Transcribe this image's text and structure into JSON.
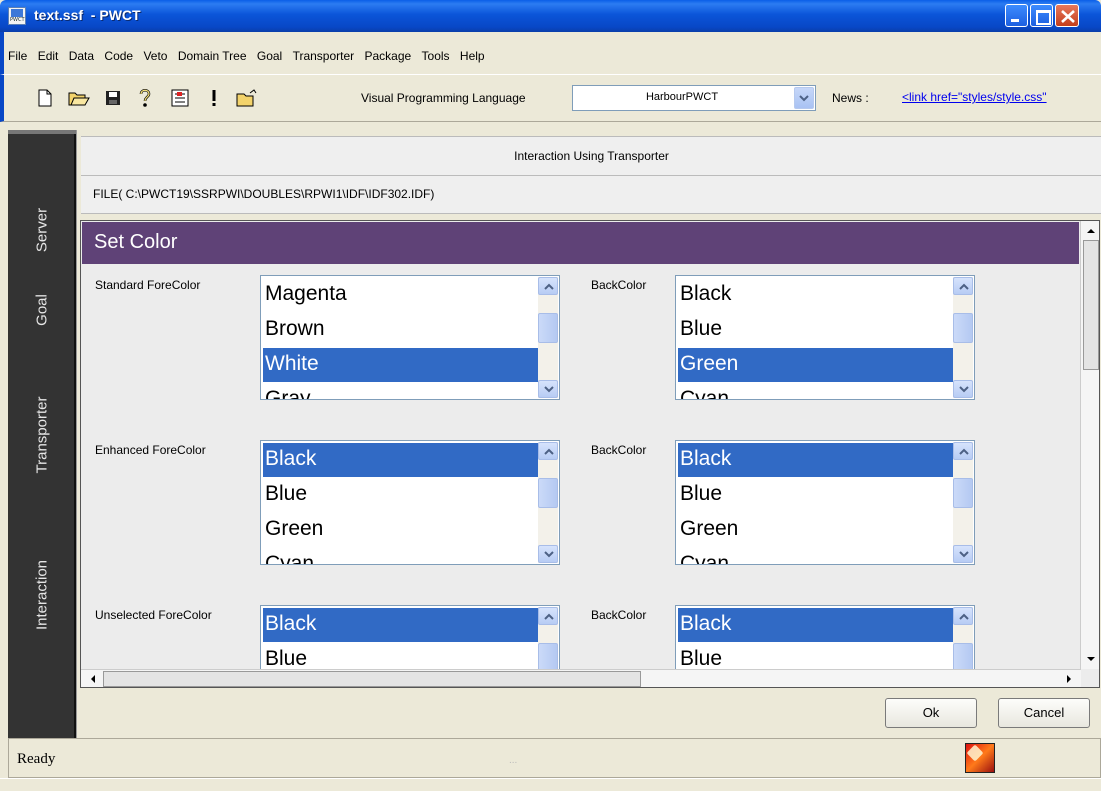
{
  "window": {
    "title": "text.ssf  - PWCT",
    "app_icon_label": "PWCT"
  },
  "menu": [
    "File",
    "Edit",
    "Data",
    "Code",
    "Veto",
    "Domain Tree",
    "Goal",
    "Transporter",
    "Package",
    "Tools",
    "Help"
  ],
  "toolbar": {
    "icons": [
      "new-file-icon",
      "open-folder-icon",
      "save-icon",
      "help-icon",
      "document-icon",
      "exclamation-icon",
      "folder-icon"
    ],
    "vpl_label": "Visual Programming Language",
    "vpl_selected": "HarbourPWCT",
    "news_label": "News :",
    "news_link": "<link href=\"styles/style.css\""
  },
  "sidebar": {
    "items": [
      "Server",
      "Goal",
      "Transporter",
      "Interaction"
    ]
  },
  "panel": {
    "header": "Interaction Using Transporter",
    "file": "FILE( C:\\PWCT19\\SSRPWI\\DOUBLES\\RPWI1\\IDF\\IDF302.IDF)",
    "form_title": "Set Color",
    "rows": [
      {
        "fore_label": "Standard ForeColor",
        "fore_items": [
          "Magenta",
          "Brown",
          "White",
          "Gray"
        ],
        "fore_selected_index": 2,
        "back_label": "BackColor",
        "back_items": [
          "Black",
          "Blue",
          "Green",
          "Cyan"
        ],
        "back_selected_index": 2
      },
      {
        "fore_label": "Enhanced ForeColor",
        "fore_items": [
          "Black",
          "Blue",
          "Green",
          "Cyan"
        ],
        "fore_selected_index": 0,
        "back_label": "BackColor",
        "back_items": [
          "Black",
          "Blue",
          "Green",
          "Cyan"
        ],
        "back_selected_index": 0
      },
      {
        "fore_label": "Unselected ForeColor",
        "fore_items": [
          "Black",
          "Blue"
        ],
        "fore_selected_index": 0,
        "back_label": "BackColor",
        "back_items": [
          "Black",
          "Blue"
        ],
        "back_selected_index": 0
      }
    ],
    "ok_label": "Ok",
    "cancel_label": "Cancel"
  },
  "status": {
    "text": "Ready",
    "grip": "..."
  },
  "colors": {
    "form_header": "#5f4277",
    "selection": "#316ac5",
    "sidebar": "#333333"
  }
}
